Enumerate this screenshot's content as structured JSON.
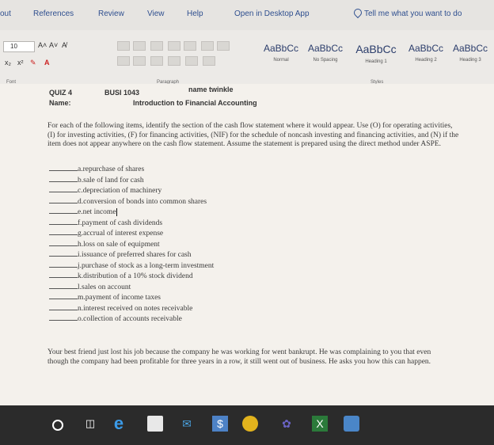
{
  "tabs": [
    "out",
    "References",
    "Review",
    "View",
    "Help",
    "Open in Desktop App"
  ],
  "tell_me": "Tell me what you want to do",
  "font": {
    "size": "10",
    "grow": "A˄",
    "shrink": "A˅",
    "clear": "A̸",
    "sub": "x₂",
    "sup": "x²",
    "highlight": "✎",
    "color": "A"
  },
  "group_labels": {
    "font": "Font",
    "paragraph": "Paragraph",
    "styles": "Styles"
  },
  "styles": [
    {
      "sample": "AaBbCc",
      "name": "Normal"
    },
    {
      "sample": "AaBbCc",
      "name": "No Spacing"
    },
    {
      "sample": "AaBbCc",
      "name": "Heading 1"
    },
    {
      "sample": "AaBbCc",
      "name": "Heading 2"
    },
    {
      "sample": "AaBbCc",
      "name": "Heading 3"
    }
  ],
  "doc": {
    "quiz": "QUIZ 4",
    "course": "BUSI 1043",
    "name_field": "name twinkle",
    "name_label": "Name:",
    "title": "Introduction to Financial Accounting",
    "instructions": "For each of the following items, identify the section of the cash flow statement where it would appear. Use (O) for operating activities, (I) for investing activities, (F) for financing activities, (NIF) for the schedule of noncash investing and financing activities, and (N) if the item does not appear anywhere on the cash flow statement. Assume the statement is prepared using the direct method under ASPE.",
    "items": [
      "a.repurchase of shares",
      "b.sale of land for cash",
      "c.depreciation of machinery",
      "d.conversion of bonds into common shares",
      "e.net income",
      "f.payment of cash dividends",
      "g.accrual of interest expense",
      "h.loss on sale of equipment",
      "i.issuance of preferred shares for cash",
      "j.purchase of stock as a long-term investment",
      "k.distribution of a 10% stock dividend",
      "l.sales on account",
      "m.payment of income taxes",
      "n.interest received on notes receivable",
      "o.collection of accounts receivable"
    ],
    "bottom": "Your best friend just lost his job because the company he was working for went bankrupt. He was complaining to you that even though the company had been profitable for three years in a row, it still went out of business. He asks you how this can happen."
  },
  "taskbar": [
    "start-circle",
    "task-view",
    "edge",
    "store",
    "mail",
    "power-apps",
    "chrome",
    "teams",
    "excel",
    "messages"
  ]
}
